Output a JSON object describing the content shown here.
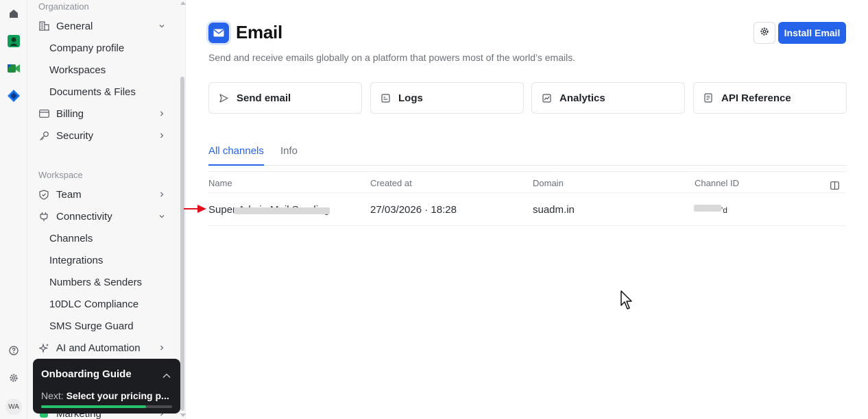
{
  "rail": {
    "icons": [
      "home-icon",
      "app-green-icon",
      "meet-icon",
      "app-blue-icon",
      "help-icon",
      "settings-icon"
    ],
    "avatar": "WA"
  },
  "sidebar": {
    "organization_label": "Organization",
    "general": "General",
    "general_items": [
      "Company profile",
      "Workspaces",
      "Documents & Files"
    ],
    "billing": "Billing",
    "security": "Security",
    "workspace_label": "Workspace",
    "team": "Team",
    "connectivity": "Connectivity",
    "connectivity_items": [
      "Channels",
      "Integrations",
      "Numbers & Senders",
      "10DLC Compliance",
      "SMS Surge Guard"
    ],
    "ai_automation": "AI and Automation",
    "marketing": "Marketing"
  },
  "onboarding": {
    "title": "Onboarding Guide",
    "next_label": "Next:",
    "next_value": "Select your pricing p...",
    "progress": 0.8
  },
  "main": {
    "title": "Email",
    "description": "Send and receive emails globally on a platform that powers most of the world’s emails.",
    "install_label": "Install Email",
    "cards": [
      "Send email",
      "Logs",
      "Analytics",
      "API Reference"
    ],
    "tabs": [
      "All channels",
      "Info"
    ],
    "active_tab": "All channels",
    "table": {
      "headers": [
        "Name",
        "Created at",
        "Domain",
        "Channel ID"
      ],
      "rows": [
        {
          "name": "Super Admin Mail Sending",
          "created_at": "27/03/2026 · 18:28",
          "domain": "suadm.in",
          "channel_id": "'d"
        }
      ]
    }
  },
  "colors": {
    "accent": "#2563eb",
    "progress": "#27c26c",
    "annotation_arrow": "#e0101e"
  }
}
